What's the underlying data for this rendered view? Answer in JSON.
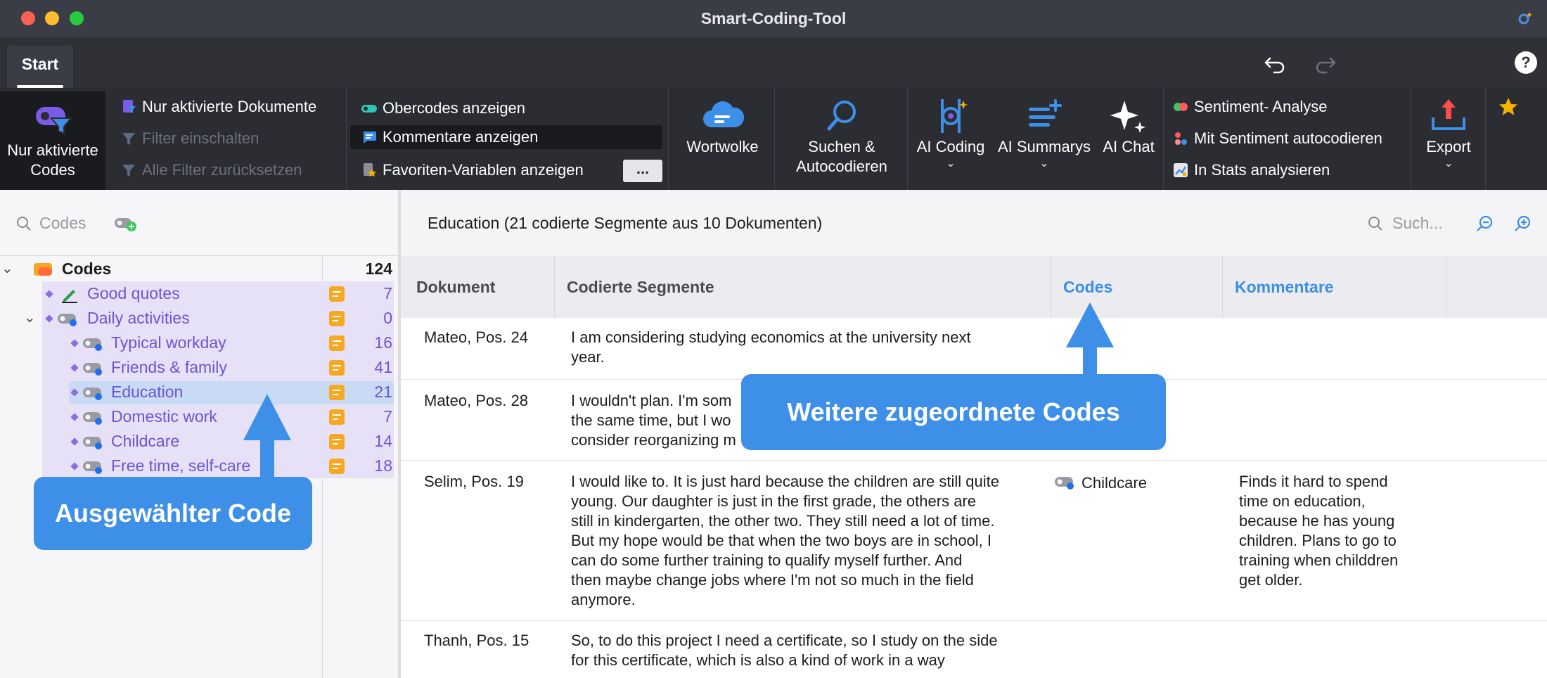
{
  "window": {
    "title": "Smart-Coding-Tool"
  },
  "tabs": [
    {
      "label": "Start"
    }
  ],
  "ribbon": {
    "nur_aktivierte_codes": "Nur aktivierte Codes",
    "doc_group": {
      "nur_aktivierte_dokumente": "Nur aktivierte Dokumente",
      "filter_einschalten": "Filter einschalten",
      "alle_filter_zuruecksetzen": "Alle Filter zurücksetzen"
    },
    "view_group": {
      "obercodes": "Obercodes anzeigen",
      "kommentare": "Kommentare anzeigen",
      "favoriten": "Favoriten-Variablen anzeigen",
      "more": "..."
    },
    "wortwolke": "Wortwolke",
    "suchen": "Suchen & Autocodieren",
    "ai_coding": "AI Coding",
    "ai_summarys": "AI Summarys",
    "ai_chat": "AI Chat",
    "sentiment_group": {
      "analyse": "Sentiment- Analyse",
      "autocodieren": "Mit Sentiment autocodieren",
      "stats": "In Stats analysieren"
    },
    "export": "Export"
  },
  "left": {
    "search_placeholder": "Codes",
    "root": {
      "label": "Codes",
      "count": "124"
    },
    "items": [
      {
        "label": "Good quotes",
        "count": "7"
      },
      {
        "label": "Daily activities",
        "count": "0"
      },
      {
        "label": "Typical workday",
        "count": "16"
      },
      {
        "label": "Friends & family",
        "count": "41"
      },
      {
        "label": "Education",
        "count": "21"
      },
      {
        "label": "Domestic work",
        "count": "7"
      },
      {
        "label": "Childcare",
        "count": "14"
      },
      {
        "label": "Free time, self-care",
        "count": "18"
      }
    ]
  },
  "right": {
    "header_title": "Education (21 codierte Segmente aus 10 Dokumenten)",
    "search_placeholder": "Such...",
    "columns": {
      "dokument": "Dokument",
      "segmente": "Codierte Segmente",
      "codes": "Codes",
      "kommentare": "Kommentare"
    },
    "rows": [
      {
        "dokument": "Mateo, Pos. 24",
        "segment_lines": [
          "I am considering studying economics at the university next",
          "year."
        ],
        "code": "",
        "comment_lines": []
      },
      {
        "dokument": "Mateo, Pos. 28",
        "segment_lines": [
          "I wouldn't plan. I'm som",
          "the same time, but I wo",
          "consider reorganizing m"
        ],
        "code": "",
        "comment_lines": []
      },
      {
        "dokument": "Selim, Pos. 19",
        "segment_lines": [
          "I would like to. It is just hard because the children are still quite",
          "young. Our daughter is just in the first grade, the others are",
          "still in kindergarten, the other two. They still need a lot of time.",
          "But my hope would be that when the two boys are in school, I",
          "can do some further training to qualify myself further. And",
          "then maybe change jobs where I'm not so much in the field",
          "anymore."
        ],
        "code": "Childcare",
        "comment_lines": [
          "Finds it hard to spend",
          "time on education,",
          "because he has young",
          "children. Plans to go to",
          "training when childdren",
          "get older."
        ]
      },
      {
        "dokument": "Thanh, Pos. 15",
        "segment_lines": [
          "So, to do this project I need a certificate, so I study on the side",
          "for this certificate, which is also a kind of work in a way"
        ],
        "code": "",
        "comment_lines": []
      }
    ]
  },
  "callouts": {
    "selected_code": "Ausgewählter Code",
    "further_codes": "Weitere zugeordnete Codes"
  },
  "colors": {
    "callout_blue": "#3d8fe8",
    "code_purple": "#6b56d3",
    "memo_orange": "#f7a823",
    "header_link_blue": "#3a8ee6"
  }
}
